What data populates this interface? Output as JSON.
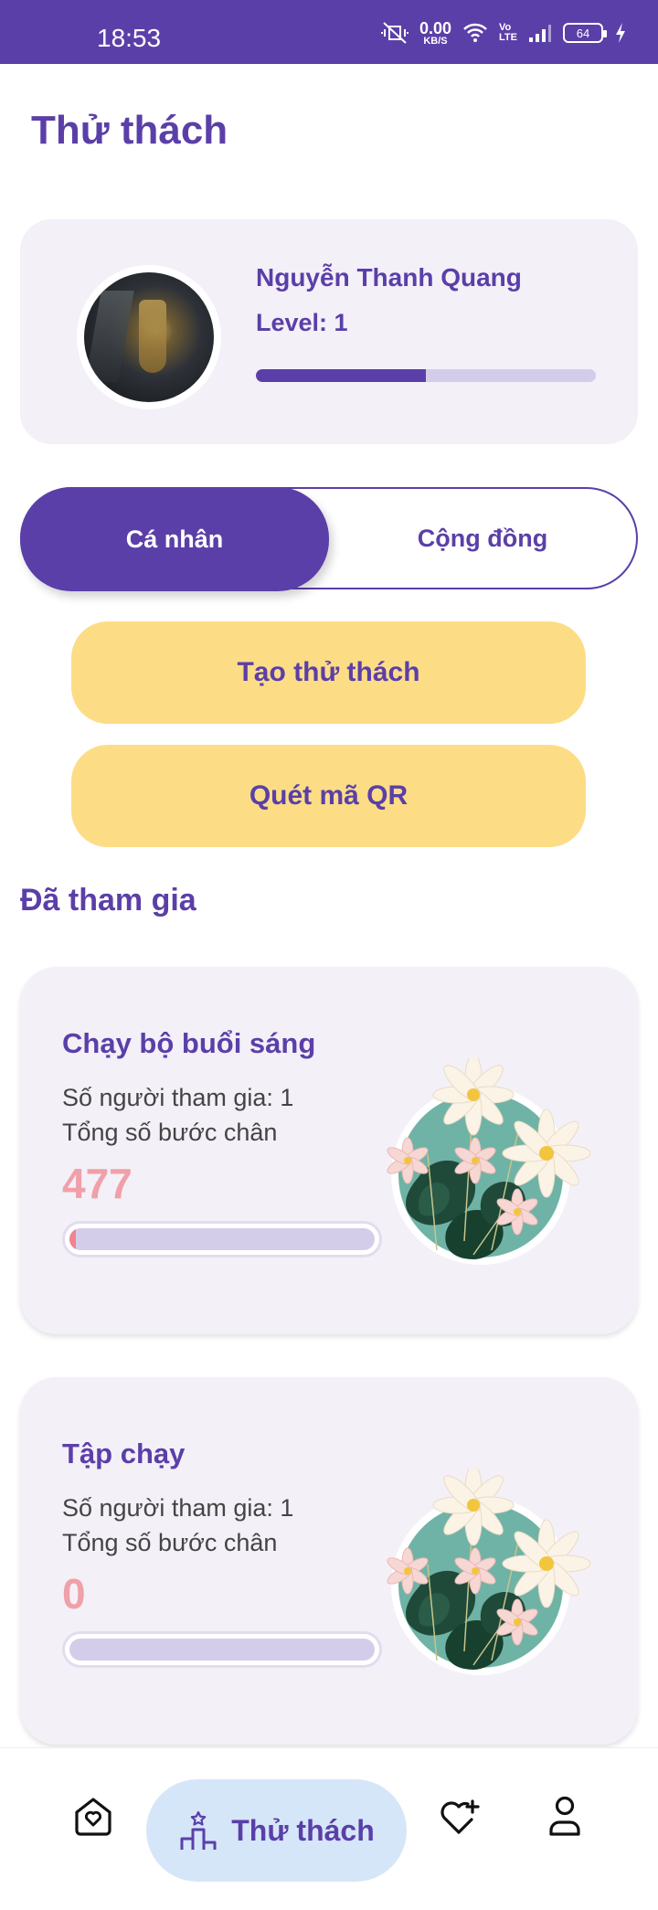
{
  "status_bar": {
    "time": "18:53",
    "net_speed": "0.00",
    "net_unit": "KB/S",
    "volte_top": "Vo",
    "volte_bottom": "LTE",
    "battery": "64"
  },
  "header": {
    "title": "Thử thách"
  },
  "profile": {
    "name": "Nguyễn Thanh Quang",
    "level_label": "Level: 1",
    "level_progress": 0.5
  },
  "tabs": {
    "active": "Cá nhân",
    "inactive": "Cộng đồng"
  },
  "actions": {
    "create": "Tạo thử thách",
    "scan": "Quét mã QR"
  },
  "joined": {
    "title": "Đã tham gia",
    "challenges": [
      {
        "title": "Chạy bộ buổi sáng",
        "participants": "Số người tham gia: 1",
        "steps_label": "Tổng số bước chân",
        "steps": "477",
        "progress": 0.02
      },
      {
        "title": "Tập chạy",
        "participants": "Số người tham gia: 1",
        "steps_label": "Tổng số bước chân",
        "steps": "0",
        "progress": 0
      }
    ]
  },
  "bottom_nav": {
    "active_label": "Thử thách",
    "icons": [
      "home-heart-icon",
      "challenge-icon",
      "heart-plus-icon",
      "person-icon"
    ]
  },
  "colors": {
    "primary": "#5b3fa8",
    "accent_yellow": "#fcdd86",
    "card_bg": "#f3f0f8",
    "steps_pink": "#f0a0a8",
    "nav_active_bg": "#d6e6f9"
  }
}
